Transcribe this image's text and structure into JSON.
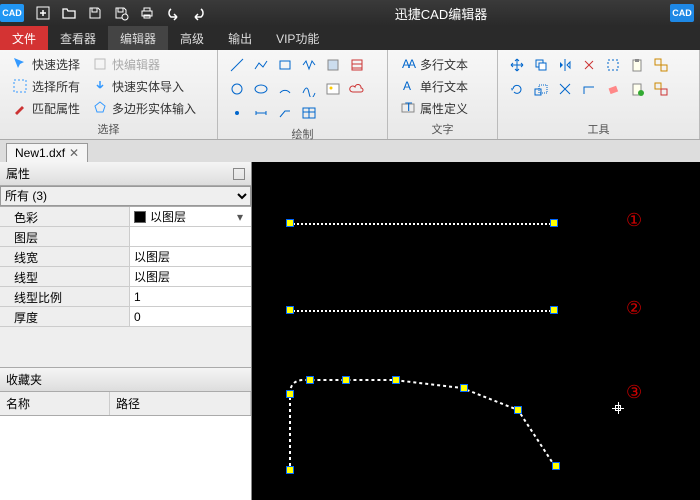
{
  "app": {
    "title": "迅捷CAD编辑器",
    "logo": "CAD"
  },
  "menu": {
    "file": "文件",
    "viewer": "查看器",
    "editor": "编辑器",
    "advanced": "高级",
    "output": "输出",
    "vip": "VIP功能"
  },
  "ribbon": {
    "select": {
      "label": "选择",
      "quick": "快速选择",
      "quick_edit": "快编辑器",
      "all": "选择所有",
      "fast_import": "快速实体导入",
      "match": "匹配属性",
      "poly_input": "多边形实体输入"
    },
    "draw": {
      "label": "绘制"
    },
    "text": {
      "label": "文字",
      "mtext": "多行文本",
      "stext": "单行文本",
      "attdef": "属性定义"
    },
    "tools": {
      "label": "工具"
    }
  },
  "tab": {
    "name": "New1.dxf"
  },
  "props": {
    "title": "属性",
    "filter": "所有 (3)",
    "rows": {
      "color": {
        "k": "色彩",
        "v": "以图层"
      },
      "layer": {
        "k": "图层",
        "v": ""
      },
      "lw": {
        "k": "线宽",
        "v": "以图层"
      },
      "lt": {
        "k": "线型",
        "v": "以图层"
      },
      "lts": {
        "k": "线型比例",
        "v": "1"
      },
      "thick": {
        "k": "厚度",
        "v": "0"
      }
    }
  },
  "fav": {
    "title": "收藏夹",
    "col1": "名称",
    "col2": "路径"
  },
  "marks": {
    "m1": "①",
    "m2": "②",
    "m3": "③"
  }
}
